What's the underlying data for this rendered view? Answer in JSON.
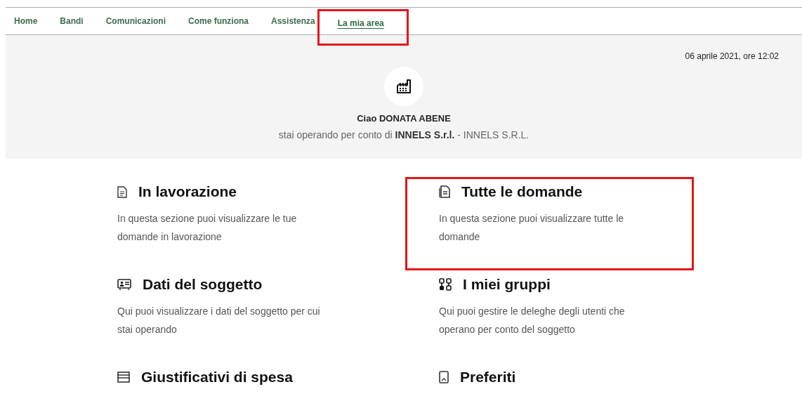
{
  "nav": [
    {
      "label": "Home",
      "selected": false,
      "highlighted": false
    },
    {
      "label": "Bandi",
      "selected": false,
      "highlighted": false
    },
    {
      "label": "Comunicazioni",
      "selected": false,
      "highlighted": false
    },
    {
      "label": "Come funziona",
      "selected": false,
      "highlighted": false
    },
    {
      "label": "Assistenza",
      "selected": false,
      "highlighted": false
    },
    {
      "label": "La mia area",
      "selected": true,
      "highlighted": true
    }
  ],
  "header": {
    "datetime": "06 aprile 2021, ore 12:02",
    "greeting": "Ciao DONATA ABENE",
    "subtitle": "stai operando per conto di **INNELS S.r.l.** - INNELS S.R.L."
  },
  "cards": [
    {
      "kind": "draft",
      "title": "In lavorazione",
      "description": "In questa sezione puoi visualizzare le tue domande in lavorazione",
      "highlighted": false
    },
    {
      "kind": "applications",
      "title": "Tutte le domande",
      "description": "In questa sezione puoi visualizzare tutte le domande",
      "highlighted": true
    },
    {
      "kind": "subject",
      "title": "Dati del soggetto",
      "description": "Qui puoi visualizzare i dati del soggetto per cui stai operando",
      "highlighted": false
    },
    {
      "kind": "groups",
      "title": "I miei gruppi",
      "description": "Qui puoi gestire le deleghe degli utenti che operano per conto del soggetto",
      "highlighted": false
    },
    {
      "kind": "expenses",
      "title": "Giustificativi di spesa",
      "highlighted": false
    },
    {
      "kind": "favorites",
      "title": "Preferiti",
      "highlighted": false
    }
  ]
}
